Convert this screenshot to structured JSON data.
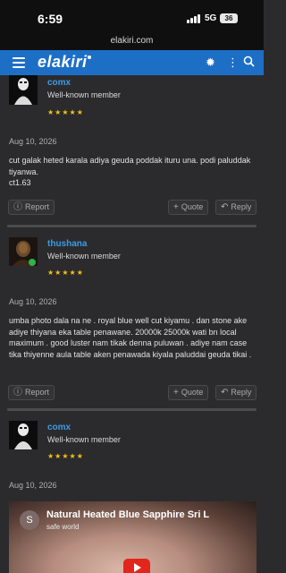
{
  "status_bar": {
    "time": "6:59",
    "network": "5G",
    "battery": "36"
  },
  "browser": {
    "url": "elakiri.com"
  },
  "header": {
    "logo": "elakiri"
  },
  "posts": [
    {
      "username": "comx",
      "user_title": "Well-known member",
      "stars": "★★★★★",
      "date": "Aug 10, 2026",
      "content": "cut galak heted karala adiya geuda poddak ituru una. podi paluddak tiyanwa.\nct1.63",
      "actions": {
        "report": "Report",
        "quote": "Quote",
        "reply": "Reply"
      }
    },
    {
      "username": "thushana",
      "user_title": "Well-known member",
      "stars": "★★★★★",
      "date": "Aug 10, 2026",
      "content": "umba photo dala na ne . royal blue well cut kiyamu . dan stone ake adiye thiyana eka table penawane. 20000k 25000k wati bn local maximum . good luster nam tikak denna puluwan . adiye nam case tika thiyenne aula table aken penawada kiyala paluddai geuda tikai .",
      "actions": {
        "report": "Report",
        "quote": "Quote",
        "reply": "Reply"
      }
    },
    {
      "username": "comx",
      "user_title": "Well-known member",
      "stars": "★★★★★",
      "date": "Aug 10, 2026",
      "video": {
        "channel_initial": "S",
        "title": "Natural Heated Blue Sapphire Sri L",
        "channel": "safe world"
      }
    }
  ],
  "colors": {
    "header": "#1d6fc6",
    "username": "#3c9be6",
    "stars": "#f2c21b",
    "background": "#2b2b2d"
  }
}
